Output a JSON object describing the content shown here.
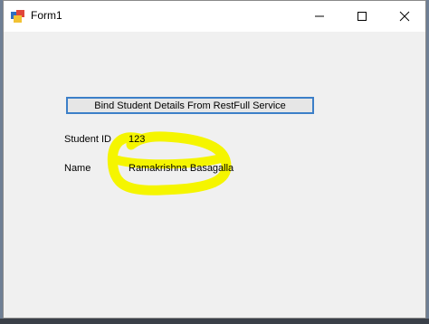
{
  "window": {
    "title": "Form1",
    "controls": {
      "minimize_symbol": "—",
      "maximize_symbol": "☐",
      "close_symbol": "✕"
    }
  },
  "form": {
    "bind_button_label": "Bind Student Details From RestFull Service",
    "student_id_label": "Student ID",
    "student_id_value": "123",
    "name_label": "Name",
    "name_value": "Ramakrishna Basagalla"
  },
  "colors": {
    "highlight": "#f5f500",
    "button_border": "#3c7fc8"
  },
  "icons": [
    "form-app-icon",
    "minimize-icon",
    "maximize-icon",
    "close-icon"
  ]
}
